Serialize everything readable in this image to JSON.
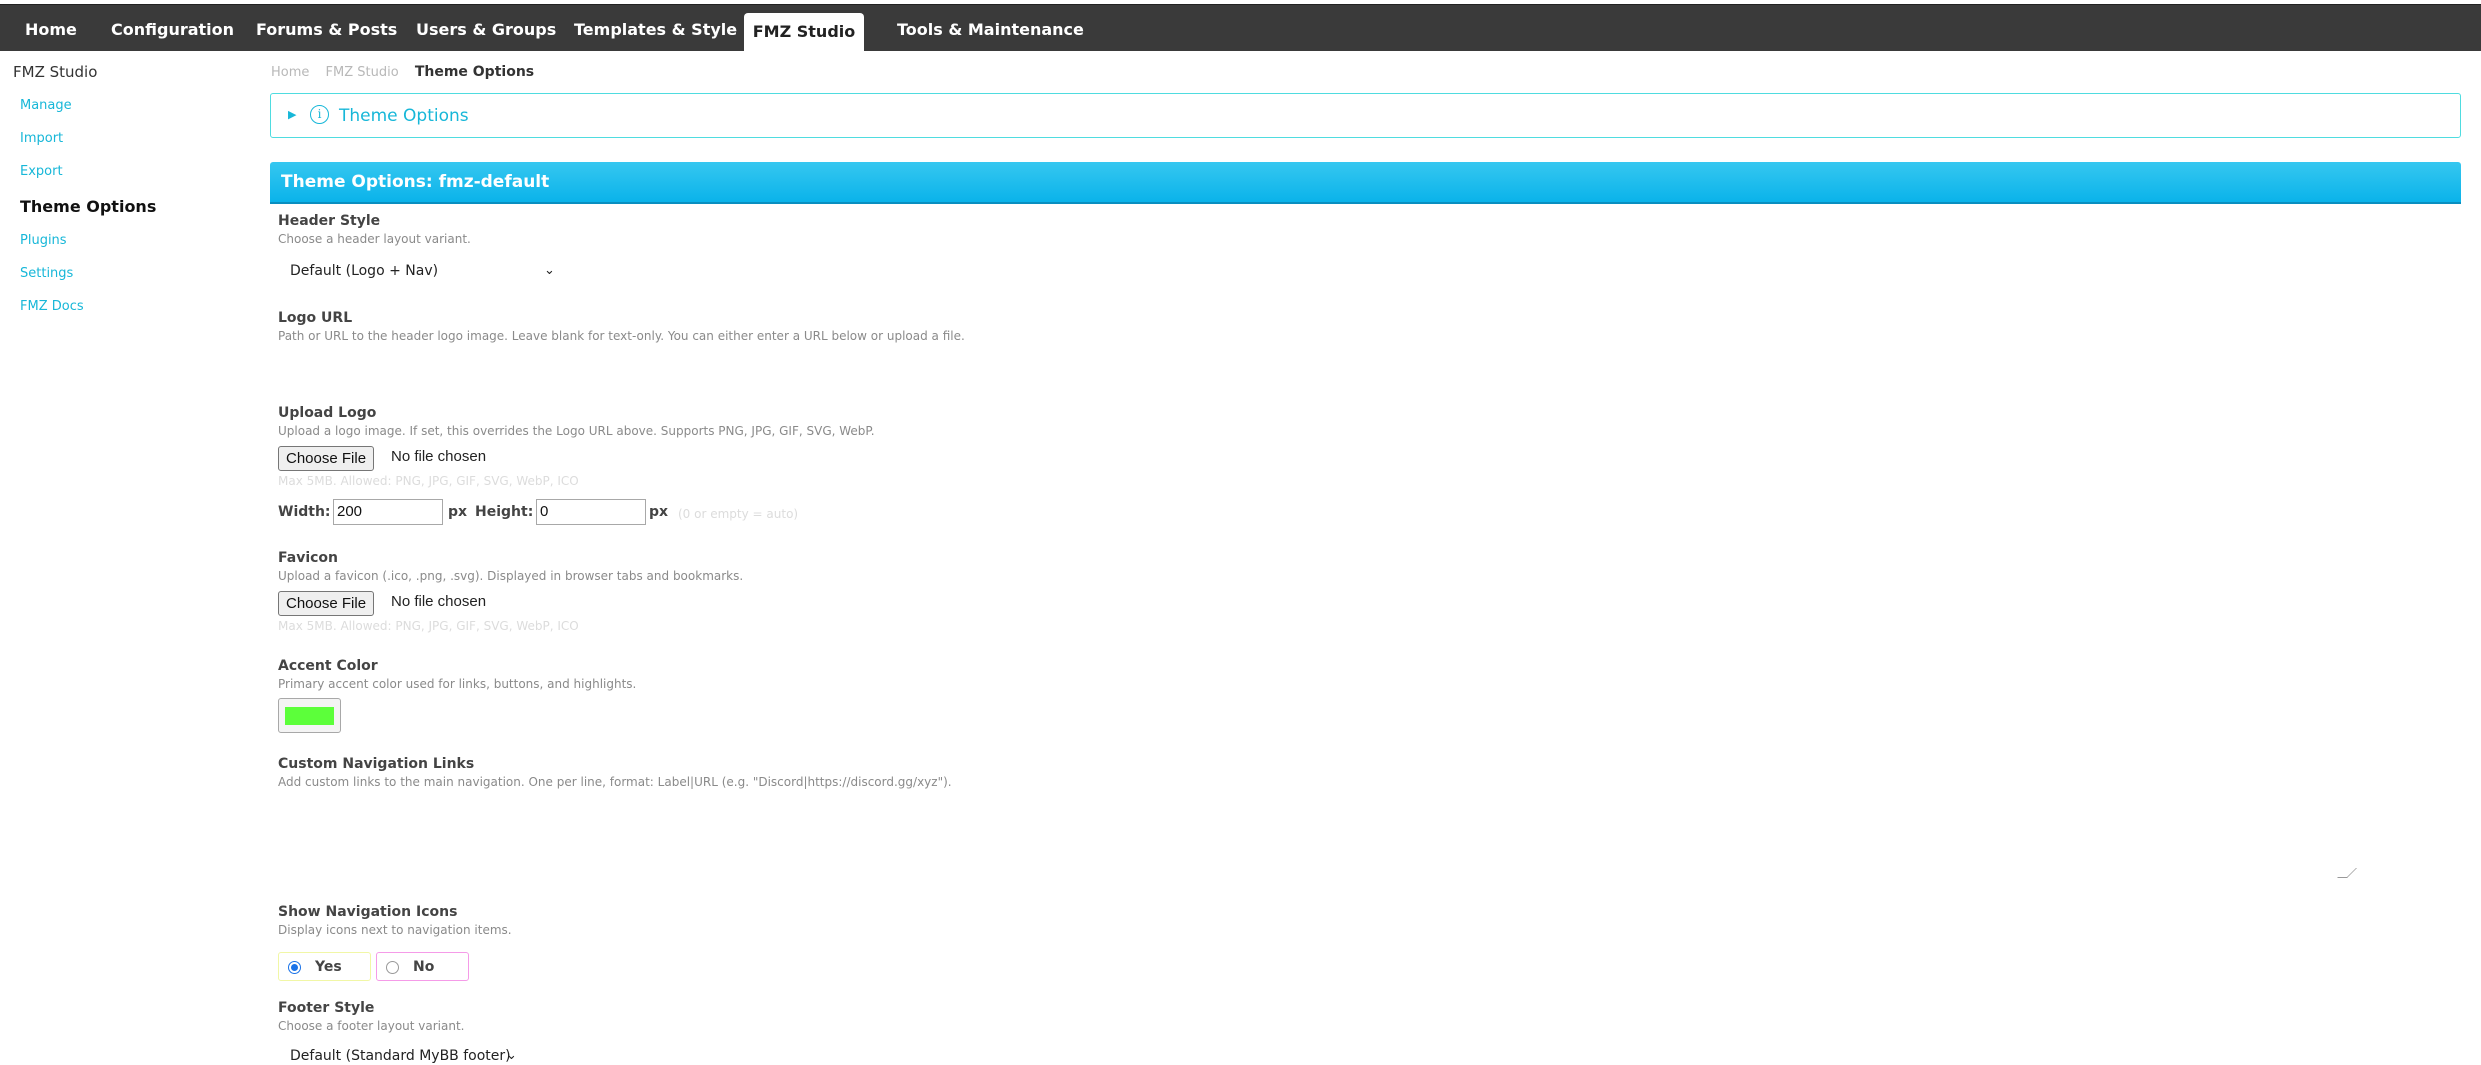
{
  "nav": {
    "tabs": [
      "Home",
      "Configuration",
      "Forums & Posts",
      "Users & Groups",
      "Templates & Style",
      "FMZ Studio",
      "Tools & Maintenance"
    ],
    "active_tab": "FMZ Studio"
  },
  "sidebar": {
    "title": "FMZ Studio",
    "items": [
      "Manage",
      "Import",
      "Export",
      "Theme Options",
      "Plugins",
      "Settings",
      "FMZ Docs"
    ],
    "active_item": "Theme Options"
  },
  "breadcrumb": [
    "Home",
    "FMZ Studio",
    "Theme Options"
  ],
  "info_box": {
    "label": "Theme Options"
  },
  "section": {
    "title": "Theme Options: fmz-default"
  },
  "fields": {
    "header_style": {
      "label": "Header Style",
      "desc": "Choose a header layout variant.",
      "value": "Default (Logo + Nav)"
    },
    "logo_url": {
      "label": "Logo URL",
      "desc": "Path or URL to the header logo image. Leave blank for text-only. You can either enter a URL below or upload a file.",
      "value": ""
    },
    "upload_logo": {
      "label": "Upload Logo",
      "desc": "Upload a logo image. If set, this overrides the Logo URL above. Supports PNG, JPG, GIF, SVG, WebP.",
      "button": "Choose File",
      "status": "No file chosen",
      "hint": "Max 5MB. Allowed: PNG, JPG, GIF, SVG, WebP, ICO",
      "width_label": "Width:",
      "width_value": "200",
      "height_label": "Height:",
      "height_value": "0",
      "unit": "px",
      "size_hint": "(0 or empty = auto)"
    },
    "favicon": {
      "label": "Favicon",
      "desc": "Upload a favicon (.ico, .png, .svg). Displayed in browser tabs and bookmarks.",
      "button": "Choose File",
      "status": "No file chosen",
      "hint": "Max 5MB. Allowed: PNG, JPG, GIF, SVG, WebP, ICO"
    },
    "accent_color": {
      "label": "Accent Color",
      "desc": "Primary accent color used for links, buttons, and highlights.",
      "value": "#5cff3a"
    },
    "custom_nav": {
      "label": "Custom Navigation Links",
      "desc": "Add custom links to the main navigation. One per line, format: Label|URL (e.g. \"Discord|https://discord.gg/xyz\").",
      "value": ""
    },
    "nav_icons": {
      "label": "Show Navigation Icons",
      "desc": "Display icons next to navigation items.",
      "options": [
        "Yes",
        "No"
      ],
      "selected": "Yes"
    },
    "footer_style": {
      "label": "Footer Style",
      "desc": "Choose a footer layout variant.",
      "value": "Default (Standard MyBB footer)"
    }
  },
  "colors": {
    "link": "#17b7d8",
    "header_bar": "#0ab3ea",
    "topbar": "#3a3a3a",
    "radio_yes_border": "#f1f7a6",
    "radio_no_border": "#f59be8"
  }
}
